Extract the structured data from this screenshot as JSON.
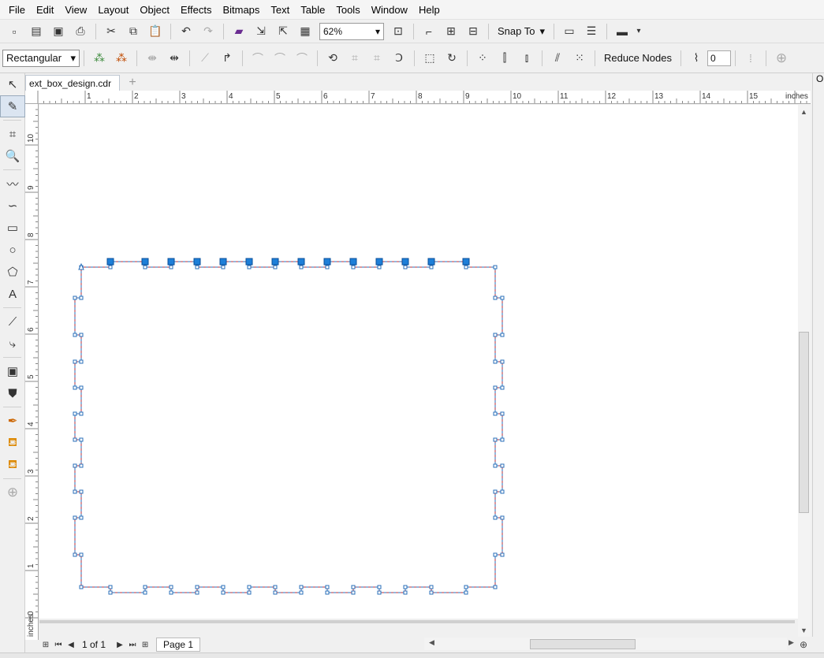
{
  "menu": [
    {
      "label": "File"
    },
    {
      "label": "Edit"
    },
    {
      "label": "View"
    },
    {
      "label": "Layout"
    },
    {
      "label": "Object"
    },
    {
      "label": "Effects"
    },
    {
      "label": "Bitmaps"
    },
    {
      "label": "Text"
    },
    {
      "label": "Table"
    },
    {
      "label": "Tools"
    },
    {
      "label": "Window"
    },
    {
      "label": "Help"
    }
  ],
  "toolbar": {
    "zoom_value": "62%",
    "snap_label": "Snap To"
  },
  "propertybar": {
    "mode_select": "Rectangular",
    "reduce_nodes_label": "Reduce Nodes",
    "smoothness_value": "0"
  },
  "document": {
    "tab_name": "ext_box_design.cdr",
    "page_indicator": "1 of 1",
    "page_tab": "Page 1"
  },
  "ruler": {
    "unit": "inches",
    "h_ticks": [
      "1",
      "2",
      "3",
      "4",
      "5",
      "6",
      "7",
      "8",
      "9",
      "10",
      "11",
      "12",
      "13",
      "14",
      "15"
    ],
    "v_ticks": [
      "10",
      "9",
      "8",
      "7",
      "6",
      "5",
      "4",
      "3",
      "2",
      "1",
      "0"
    ]
  },
  "docker": {
    "label": "O"
  }
}
